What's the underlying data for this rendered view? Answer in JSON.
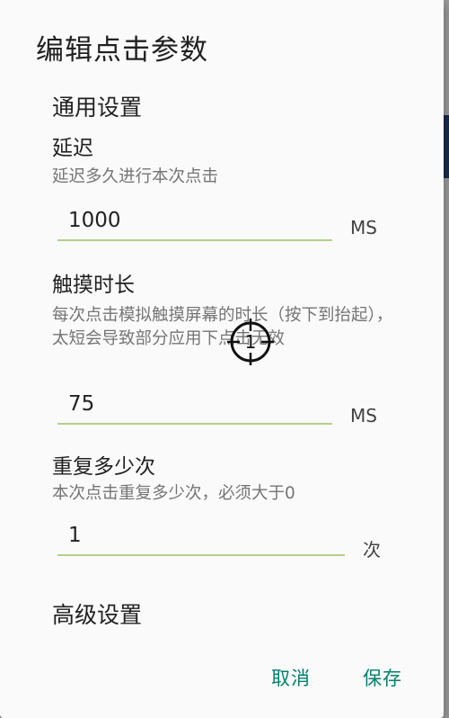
{
  "dialog": {
    "title": "编辑点击参数",
    "general_section": "通用设置",
    "advanced_section": "高级设置"
  },
  "delay": {
    "title": "延迟",
    "description": "延迟多久进行本次点击",
    "value": "1000",
    "unit": "MS"
  },
  "touch_duration": {
    "title": "触摸时长",
    "description": "每次点击模拟触摸屏幕的时长（按下到抬起），太短会导致部分应用下点击无效",
    "value": "75",
    "unit": "MS"
  },
  "repeat": {
    "title": "重复多少次",
    "description": "本次点击重复多少次，必须大于0",
    "value": "1",
    "unit": "次"
  },
  "actions": {
    "cancel": "取消",
    "save": "保存"
  },
  "overlay": {
    "target_number": "1"
  },
  "colors": {
    "accent": "#00806f",
    "underline": "#b5cf8a"
  }
}
